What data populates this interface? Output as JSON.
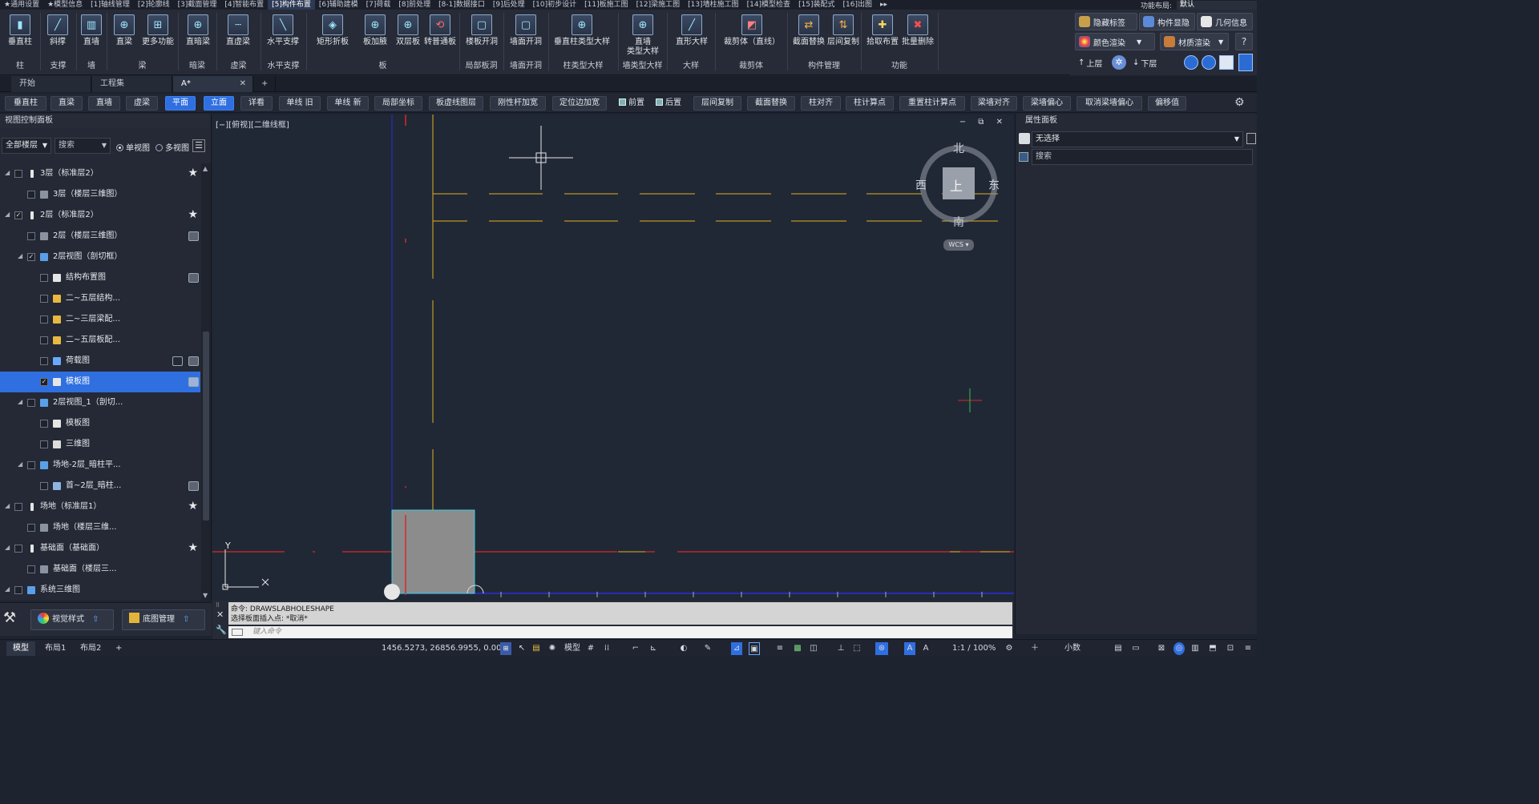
{
  "top_tabs": [
    "★通用设置",
    "★模型信息",
    "[1]轴线管理",
    "[2]轮廓线",
    "[3]截面管理",
    "[4]智能布置",
    "[5]构件布置",
    "[6]辅助建模",
    "[7]荷载",
    "[8]前处理",
    "[8-1]数据接口",
    "[9]后处理",
    "[10]初步设计",
    "[11]板施工图",
    "[12]梁施工图",
    "[13]墙柱施工图",
    "[14]模型检查",
    "[15]装配式",
    "[16]出图",
    "▸▸"
  ],
  "top_active": "[5]构件布置",
  "layout": {
    "label": "功能布局:",
    "value": "默认"
  },
  "ribbon": {
    "buttons": [
      "垂直柱",
      "斜撑",
      "直墙",
      "直梁",
      "更多功能",
      "直暗梁",
      "直虚梁",
      "水平支撑",
      "矩形折板",
      "板加腋",
      "双层板",
      "转普通板",
      "楼板开洞",
      "墙面开洞",
      "垂直柱类型大样",
      "直墙",
      "类型大样",
      "直形大样",
      "裁剪体（直线）",
      "截面替换",
      "层间复制",
      "拾取布置",
      "批量删除"
    ],
    "groups": [
      "柱",
      "支撑",
      "墙",
      "梁",
      "暗梁",
      "虚梁",
      "水平支撑",
      "板",
      "局部板洞",
      "墙面开洞",
      "柱类型大样",
      "墙类型大样",
      "大样",
      "裁剪体",
      "构件管理",
      "功能"
    ]
  },
  "ribbon_right": [
    "隐藏标签",
    "构件显隐",
    "几何信息",
    "颜色渲染",
    "材质渲染",
    "上层",
    "下层"
  ],
  "doc_tabs": [
    "开始",
    "工程集",
    "A*",
    "+"
  ],
  "cmd_buttons": [
    "垂直柱",
    "直梁",
    "直墙",
    "虚梁",
    "平面",
    "立面",
    "详看",
    "单线 旧",
    "单线 新",
    "局部坐标",
    "板虚线图层",
    "刚性杆加宽",
    "定位边加宽",
    "前置",
    "后置",
    "层间复制",
    "截面替换",
    "柱对齐",
    "柱计算点",
    "重置柱计算点",
    "梁墙对齐",
    "梁墙偏心",
    "取消梁墙偏心",
    "偏移值"
  ],
  "left_panel": {
    "title": "视图控制面板",
    "floor_filter": "全部楼层",
    "search": "搜索",
    "single_view": "单视图",
    "multi_view": "多视图",
    "tree": [
      "3层（标准层2）",
      "3层（楼层三维图）",
      "2层（标准层2）",
      "2层（楼层三维图）",
      "2层视图（剖切框）",
      "结构布置图",
      "二~五层结构...",
      "二~三层梁配...",
      "二~五层板配...",
      "荷载图",
      "模板图",
      "2层视图_1（剖切...",
      "模板图",
      "三维图",
      "场地-2层_暗柱平...",
      "首~2层_暗柱...",
      "场地（标准层1）",
      "场地（楼层三维...",
      "基础面（基础面）",
      "基础面（楼层三...",
      "系统三维图"
    ],
    "bottom": [
      "视觉样式",
      "底图管理"
    ]
  },
  "canvas": {
    "view_label": "[−][俯视][二维线框]",
    "view_controls": "− ⧉ ✕",
    "compass": {
      "north": "北",
      "south": "南",
      "east": "东",
      "west": "西",
      "top": "上",
      "wcs": "WCS"
    },
    "ucs": {
      "y": "Y",
      "x": "X"
    }
  },
  "right_panel": {
    "title": "属性面板",
    "selection": "无选择",
    "search": "搜索"
  },
  "command": {
    "line1": "命令:  DRAWSLABHOLESHAPE",
    "line2": "选择板面插入点: *取消*",
    "placeholder": "键入命令"
  },
  "status": {
    "tabs": [
      "模型",
      "布局1",
      "布局2",
      "+"
    ],
    "coords": "1456.5273, 26856.9955, 0.0000",
    "model": "模型",
    "scale": "1:1 / 100%",
    "units": "小数"
  },
  "colors": {
    "accent": "#2f6fe0",
    "canvas": "#212835",
    "wall_yellow": "#e0b020",
    "axis_red": "#d42a2a",
    "axis_blue": "#2a2ae0"
  }
}
